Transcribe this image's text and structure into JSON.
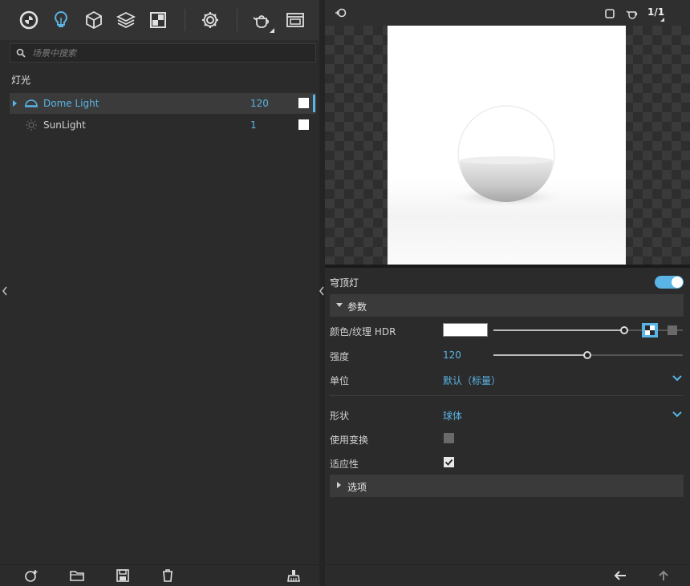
{
  "search": {
    "placeholder": "场景中搜索"
  },
  "section_title": "灯光",
  "lights": [
    {
      "name": "Dome Light",
      "value": "120",
      "icon": "dome-light-icon",
      "selected": true
    },
    {
      "name": "SunLight",
      "value": "1",
      "icon": "sun-icon",
      "selected": false
    }
  ],
  "preview": {
    "counter": "1/1"
  },
  "properties": {
    "title": "穹顶灯",
    "enabled": true,
    "group_params": "参数",
    "color_label": "颜色/纹理 HDR",
    "intensity_label": "强度",
    "intensity_value": "120",
    "unit_label": "单位",
    "unit_value": "默认（标量）",
    "shape_label": "形状",
    "shape_value": "球体",
    "use_transform_label": "使用变换",
    "use_transform_checked": false,
    "adaptive_label": "适应性",
    "adaptive_checked": true,
    "group_options": "选项"
  },
  "colors": {
    "accent": "#5ab4e6",
    "panel": "#2b2b2b",
    "header": "#3a3a3a"
  }
}
